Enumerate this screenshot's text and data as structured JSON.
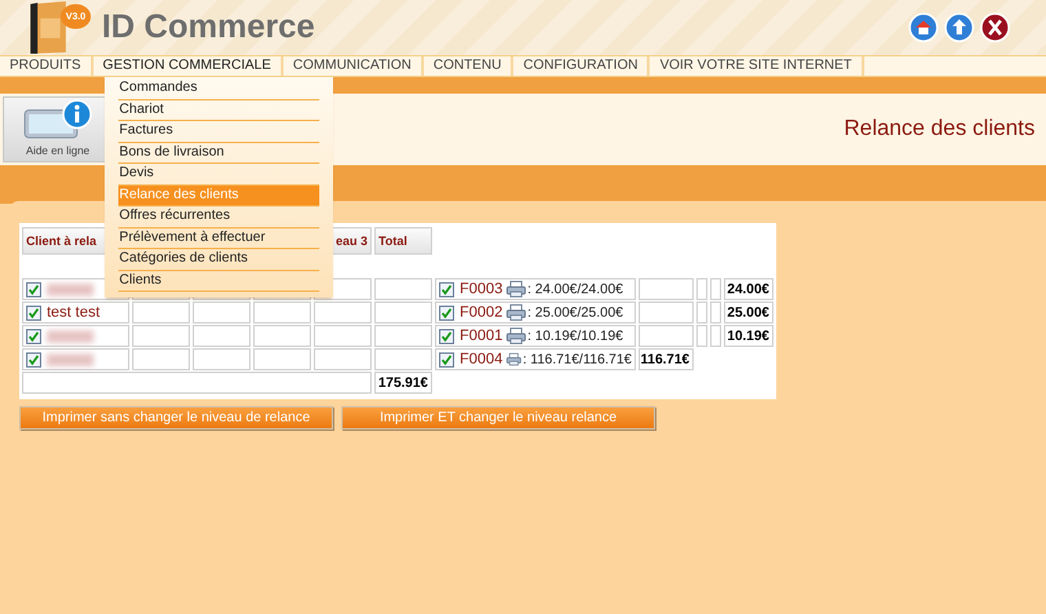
{
  "header": {
    "logo_badge": "V3.0",
    "logo_text": "ID Commerce"
  },
  "nav": [
    {
      "label": "PRODUITS",
      "expanded": false
    },
    {
      "label": "GESTION COMMERCIALE",
      "expanded": true,
      "children": [
        {
          "label": "Commandes",
          "selected": false
        },
        {
          "label": "Chariot",
          "selected": false
        },
        {
          "label": "Factures",
          "selected": false
        },
        {
          "label": "Bons de livraison",
          "selected": false
        },
        {
          "label": "Devis",
          "selected": false
        },
        {
          "label": "Relance des clients",
          "selected": true
        },
        {
          "label": "Offres récurrentes",
          "selected": false
        },
        {
          "label": "Prélèvement à effectuer",
          "selected": false
        },
        {
          "label": "Catégories de clients",
          "selected": false
        },
        {
          "label": "Clients",
          "selected": false
        }
      ]
    },
    {
      "label": "COMMUNICATION",
      "expanded": false
    },
    {
      "label": "CONTENU",
      "expanded": false
    },
    {
      "label": "CONFIGURATION",
      "expanded": false
    },
    {
      "label": "VOIR VOTRE SITE INTERNET",
      "expanded": false
    }
  ],
  "help_button": {
    "label": "Aide en ligne"
  },
  "page_title": "Relance des clients",
  "table": {
    "columns": [
      "Client à rela",
      "",
      "",
      "",
      "eau 3",
      "Total"
    ],
    "rows": [
      {
        "checked": true,
        "name_blurred": true,
        "invoice": {
          "checked": true,
          "number": "F0003",
          "amount": ": 24.00€/24.00€"
        },
        "kind": "padded",
        "total": "24.00€"
      },
      {
        "checked": true,
        "name_blurred": false,
        "name": "test test",
        "invoice": {
          "checked": true,
          "number": "F0002",
          "amount": ": 25.00€/25.00€"
        },
        "kind": "padded",
        "total": "25.00€"
      },
      {
        "checked": true,
        "name_blurred": true,
        "invoice": {
          "checked": true,
          "number": "F0001",
          "amount": ": 10.19€/10.19€"
        },
        "kind": "padded",
        "total": "10.19€"
      },
      {
        "checked": true,
        "name_blurred": true,
        "invoice": {
          "checked": true,
          "number": "F0004",
          "amount": ": 116.71€/116.71€"
        },
        "kind": "compact",
        "total": "116.71€"
      }
    ],
    "grand_total": "175.91€"
  },
  "buttons": [
    "Imprimer sans changer le niveau de relance",
    "Imprimer ET changer le niveau relance"
  ]
}
